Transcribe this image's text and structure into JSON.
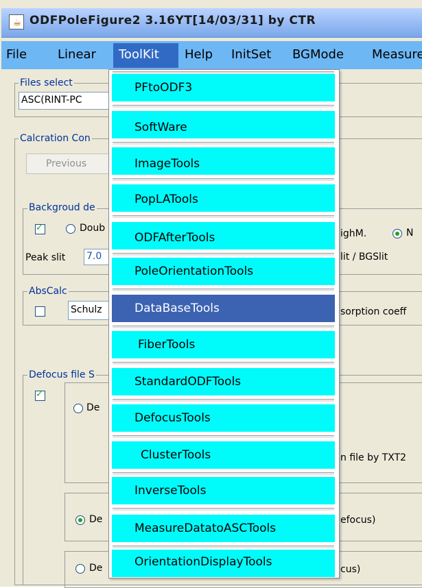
{
  "window": {
    "title": "ODFPoleFigure2 3.16YT[14/03/31] by CTR",
    "icon": "java-app-icon"
  },
  "menubar": {
    "items": [
      "File",
      "Linear",
      "ToolKit",
      "Help",
      "InitSet",
      "BGMode",
      "Measure"
    ],
    "active": "ToolKit"
  },
  "background": {
    "files_select": {
      "label": "Files select",
      "value": "ASC(RINT-PC"
    },
    "calc_condition": {
      "label": "Calcration Con",
      "previous_button": "Previous"
    },
    "background_detect": {
      "label": "Backgroud de",
      "double_option": "Doub",
      "high_label": "ighM.",
      "peak_slit_label": "Peak slit",
      "peak_slit_value": "7.0",
      "slit_ratio_label": "lit / BGSlit"
    },
    "abs_calc": {
      "label": "AbsCalc",
      "method": "Schulz",
      "coeff_label": "sorption coeff"
    },
    "defocus": {
      "label": "Defocus file S",
      "option1": "De",
      "file_label": "n file by TXT2",
      "option2": "De",
      "option2_suffix": "efocus)",
      "option3": "De",
      "option3_suffix": "cus)"
    }
  },
  "toolkit_menu": {
    "items": [
      "PFtoODF3",
      "SoftWare",
      "ImageTools",
      "PopLATools",
      "ODFAfterTools",
      "PoleOrientationTools",
      "DataBaseTools",
      "FiberTools",
      "StandardODFTools",
      "DefocusTools",
      "ClusterTools",
      "InverseTools",
      "MeasureDatatoASCTools",
      "OrientationDisplayTools"
    ],
    "selected": "DataBaseTools"
  },
  "colors": {
    "menubar": "#6eb7f5",
    "menu_item": "#00fbfb",
    "selected_item": "#3b63b2",
    "group_label": "#00309c"
  }
}
